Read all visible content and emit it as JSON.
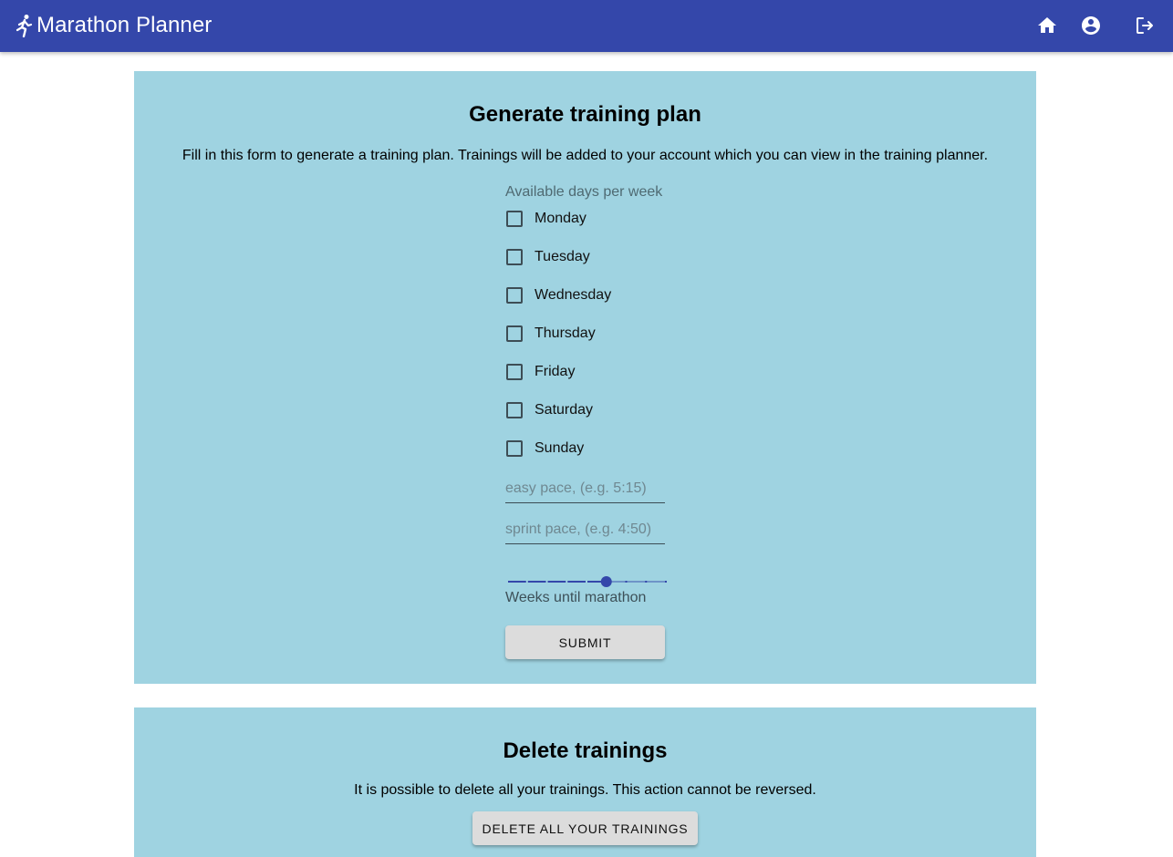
{
  "appbar": {
    "title": "Marathon Planner",
    "brand_icon": "running-person-icon",
    "icons": [
      "home-icon",
      "account-circle-icon",
      "logout-icon"
    ],
    "color": "#3447aa"
  },
  "generate": {
    "title": "Generate training plan",
    "description": "Fill in this form to generate a training plan. Trainings will be added to your account which you can view in the training planner.",
    "days_legend": "Available days per week",
    "days": [
      {
        "label": "Monday",
        "checked": false
      },
      {
        "label": "Tuesday",
        "checked": false
      },
      {
        "label": "Wednesday",
        "checked": false
      },
      {
        "label": "Thursday",
        "checked": false
      },
      {
        "label": "Friday",
        "checked": false
      },
      {
        "label": "Saturday",
        "checked": false
      },
      {
        "label": "Sunday",
        "checked": false
      }
    ],
    "easy_pace": {
      "value": "",
      "placeholder": "easy pace, (e.g. 5:15)"
    },
    "sprint_pace": {
      "value": "",
      "placeholder": "sprint pace, (e.g. 4:50)"
    },
    "weeks_slider": {
      "label": "Weeks until marathon",
      "steps": 9,
      "selected_index": 5
    },
    "submit_label": "Submit"
  },
  "delete": {
    "title": "Delete trainings",
    "description": "It is possible to delete all your trainings. This action cannot be reversed.",
    "button_label": "Delete all your trainings"
  },
  "colors": {
    "card_background": "#9fd3e1",
    "accent": "#3447aa",
    "button": "#dcdcdc"
  }
}
